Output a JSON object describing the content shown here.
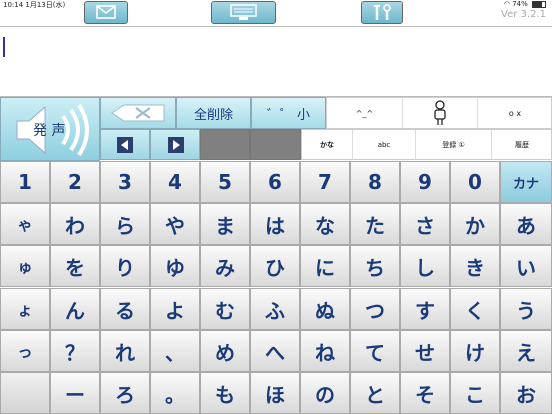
{
  "status": {
    "time": "10:14  1月13日(水)",
    "battery": "74%"
  },
  "version": "Ver 3.2.1",
  "speak_label": "発 声",
  "toolbar": {
    "clear_all": "全削除",
    "small_kana": "゛゜ 小"
  },
  "row1_cells": [
    "^_^",
    "",
    "o x"
  ],
  "tabs": [
    "かな",
    "abc",
    "登録 ①",
    "履歴"
  ],
  "keyboard_rows": [
    [
      "1",
      "2",
      "3",
      "4",
      "5",
      "6",
      "7",
      "8",
      "9",
      "0",
      "カナ"
    ],
    [
      "ゃ",
      "わ",
      "ら",
      "や",
      "ま",
      "は",
      "な",
      "た",
      "さ",
      "か",
      "あ"
    ],
    [
      "ゅ",
      "を",
      "り",
      "ゆ",
      "み",
      "ひ",
      "に",
      "ち",
      "し",
      "き",
      "い"
    ],
    [
      "ょ",
      "ん",
      "る",
      "よ",
      "む",
      "ふ",
      "ぬ",
      "つ",
      "す",
      "く",
      "う"
    ],
    [
      "っ",
      "？",
      "れ",
      "、",
      "め",
      "へ",
      "ね",
      "て",
      "せ",
      "け",
      "え"
    ],
    [
      "",
      "ー",
      "ろ",
      "。",
      "も",
      "ほ",
      "の",
      "と",
      "そ",
      "こ",
      "お"
    ]
  ]
}
